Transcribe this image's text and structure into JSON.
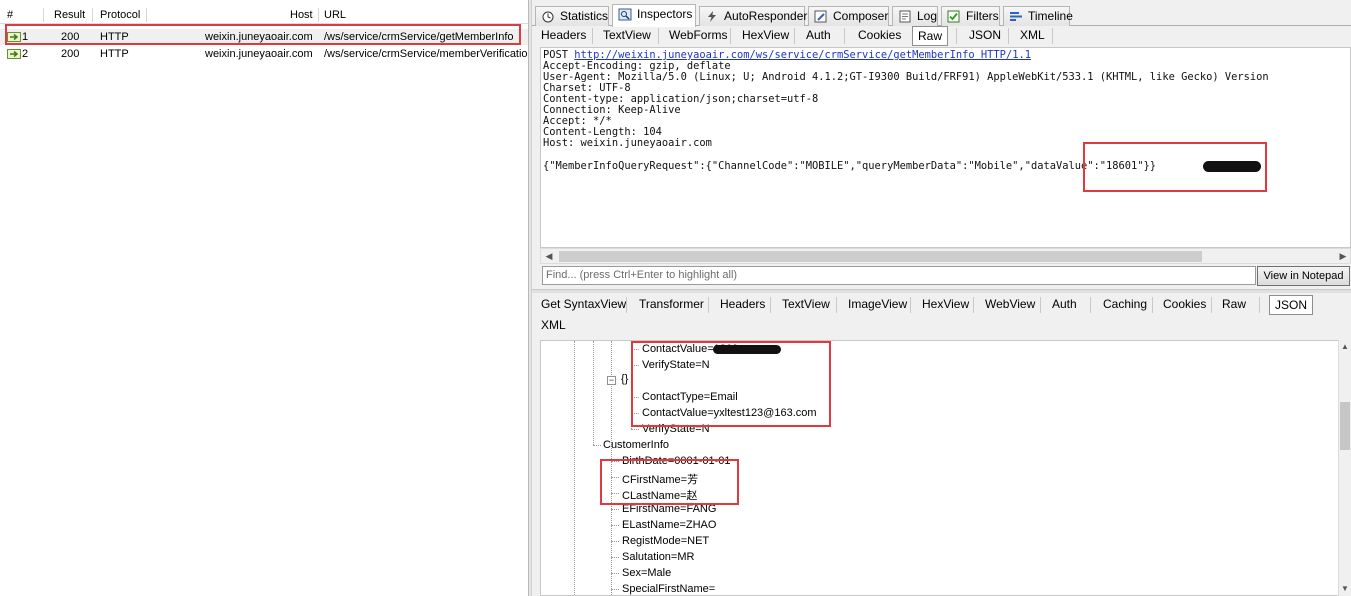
{
  "sessions": {
    "columns": [
      "#",
      "Result",
      "Protocol",
      "Host",
      "URL"
    ],
    "rows": [
      {
        "num": "1",
        "result": "200",
        "protocol": "HTTP",
        "host": "weixin.juneyaoair.com",
        "url": "/ws/service/crmService/getMemberInfo"
      },
      {
        "num": "2",
        "result": "200",
        "protocol": "HTTP",
        "host": "weixin.juneyaoair.com",
        "url": "/ws/service/crmService/memberVerification"
      }
    ]
  },
  "main_tabs": [
    "Statistics",
    "Inspectors",
    "AutoResponder",
    "Composer",
    "Log",
    "Filters",
    "Timeline"
  ],
  "request_tabs": [
    "Headers",
    "TextView",
    "WebForms",
    "HexView",
    "Auth",
    "Cookies",
    "Raw",
    "JSON",
    "XML"
  ],
  "request": {
    "method": "POST",
    "url": "http://weixin.juneyaoair.com/ws/service/crmService/getMemberInfo HTTP/1.1",
    "headers": [
      "Accept-Encoding: gzip, deflate",
      "User-Agent: Mozilla/5.0 (Linux; U; Android 4.1.2;GT-I9300 Build/FRF91) AppleWebKit/533.1 (KHTML, like Gecko) Version",
      "Charset: UTF-8",
      "Content-type: application/json;charset=utf-8",
      "Connection: Keep-Alive",
      "Accept: */*",
      "Content-Length: 104",
      "Host: weixin.juneyaoair.com"
    ],
    "body": "{\"MemberInfoQueryRequest\":{\"ChannelCode\":\"MOBILE\",\"queryMemberData\":\"Mobile\",\"dataValue\":\"18601\"}}"
  },
  "find": {
    "placeholder": "Find... (press Ctrl+Enter to highlight all)",
    "button_label": "View in Notepad"
  },
  "response_tabs": [
    "Get SyntaxView",
    "Transformer",
    "Headers",
    "TextView",
    "ImageView",
    "HexView",
    "WebView",
    "Auth",
    "Caching",
    "Cookies",
    "Raw",
    "JSON",
    "XML"
  ],
  "tree": {
    "contact1": [
      "ContactValue=1860",
      "VerifyState=N"
    ],
    "object_brace": "{}",
    "contact2": [
      "ContactType=Email",
      "ContactValue=yxltest123@163.com",
      "VerifyState=N"
    ],
    "customer_info": "CustomerInfo",
    "customer_fields": [
      "BirthDate=0001-01-01",
      "CFirstName=芳",
      "CLastName=赵",
      "EFirstName=FANG",
      "ELastName=ZHAO",
      "RegistMode=NET",
      "Salutation=MR",
      "Sex=Male",
      "SpecialFirstName="
    ]
  },
  "colors": {
    "highlight": "#e03a3e",
    "link": "#1d34c8"
  }
}
